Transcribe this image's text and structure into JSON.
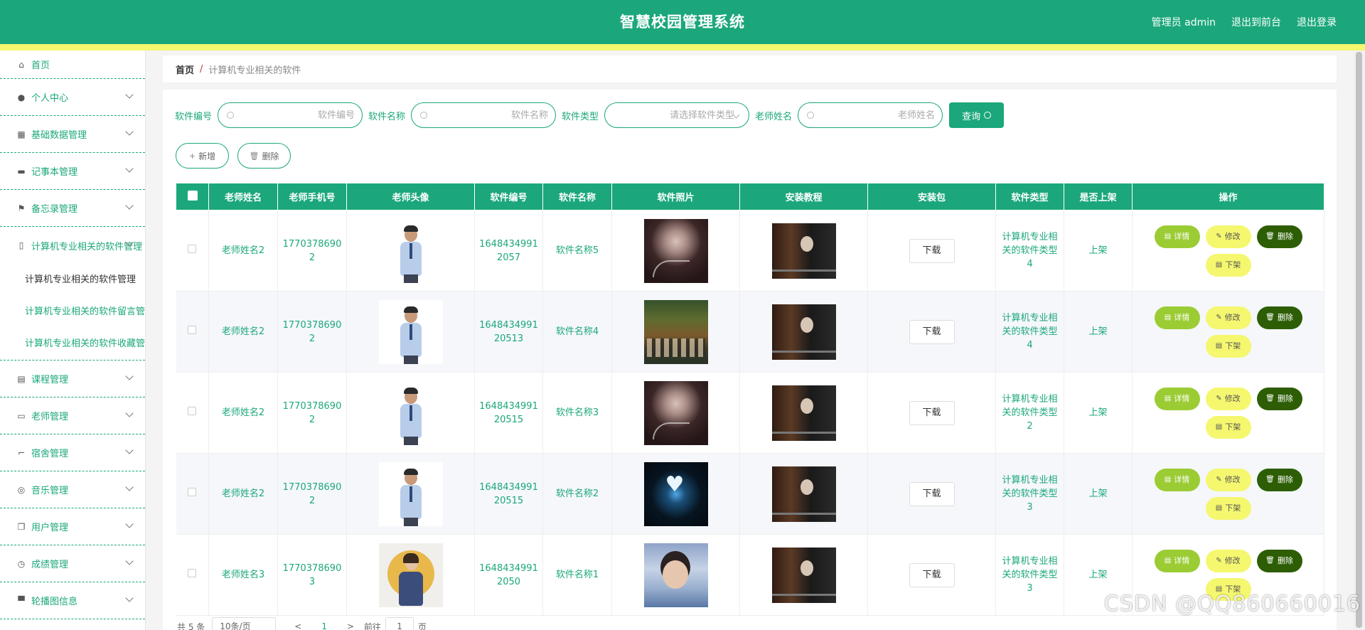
{
  "app": {
    "title": "智慧校园管理系统"
  },
  "topbar": {
    "user": "管理员 admin",
    "to_front": "退出到前台",
    "logout": "退出登录"
  },
  "sidebar": {
    "items": [
      {
        "label": "首页",
        "icon": "home-icon"
      },
      {
        "label": "个人中心",
        "icon": "user-icon"
      },
      {
        "label": "基础数据管理",
        "icon": "grid-icon"
      },
      {
        "label": "记事本管理",
        "icon": "briefcase-icon"
      },
      {
        "label": "备忘录管理",
        "icon": "flag-icon"
      },
      {
        "label": "计算机专业相关的软件管理",
        "icon": "mic-icon"
      },
      {
        "label": "课程管理",
        "icon": "clipboard-icon"
      },
      {
        "label": "老师管理",
        "icon": "id-card-icon"
      },
      {
        "label": "宿舍管理",
        "icon": "crop-icon"
      },
      {
        "label": "音乐管理",
        "icon": "aperture-icon"
      },
      {
        "label": "用户管理",
        "icon": "copy-icon"
      },
      {
        "label": "成绩管理",
        "icon": "compass-icon"
      },
      {
        "label": "轮播图信息",
        "icon": "stamp-icon"
      }
    ],
    "submenu": [
      "计算机专业相关的软件管理",
      "计算机专业相关的软件留言管理",
      "计算机专业相关的软件收藏管理"
    ]
  },
  "breadcrumb": {
    "home": "首页",
    "sep": "/",
    "current": "计算机专业相关的软件"
  },
  "search": {
    "labels": {
      "number": "软件编号",
      "name": "软件名称",
      "type": "软件类型",
      "teacher": "老师姓名"
    },
    "placeholders": {
      "number": "软件编号",
      "name": "软件名称",
      "type": "请选择软件类型",
      "teacher": "老师姓名"
    },
    "query_label": "查询"
  },
  "actions": {
    "add": "新增",
    "delete": "删除"
  },
  "table": {
    "headers": [
      "老师姓名",
      "老师手机号",
      "老师头像",
      "软件编号",
      "软件名称",
      "软件照片",
      "安装教程",
      "安装包",
      "软件类型",
      "是否上架",
      "操作"
    ],
    "download_label": "下载",
    "op_labels": {
      "detail": "详情",
      "edit": "修改",
      "delete": "删除",
      "down": "下架"
    },
    "rows": [
      {
        "teacher": "老师姓名2",
        "phone": "17703786902",
        "number": "16484349912057",
        "name": "软件名称5",
        "type": "计算机专业相关的软件类型4",
        "status": "上架",
        "avatar": "male",
        "photo": "photo1"
      },
      {
        "teacher": "老师姓名2",
        "phone": "17703786902",
        "number": "164843499120513",
        "name": "软件名称4",
        "type": "计算机专业相关的软件类型4",
        "status": "上架",
        "avatar": "male",
        "photo": "photo2"
      },
      {
        "teacher": "老师姓名2",
        "phone": "17703786902",
        "number": "164843499120515",
        "name": "软件名称3",
        "type": "计算机专业相关的软件类型2",
        "status": "上架",
        "avatar": "male",
        "photo": "photo1"
      },
      {
        "teacher": "老师姓名2",
        "phone": "17703786902",
        "number": "164843499120515",
        "name": "软件名称2",
        "type": "计算机专业相关的软件类型3",
        "status": "上架",
        "avatar": "male",
        "photo": "photo3"
      },
      {
        "teacher": "老师姓名3",
        "phone": "17703786903",
        "number": "16484349912050",
        "name": "软件名称1",
        "type": "计算机专业相关的软件类型3",
        "status": "上架",
        "avatar": "female",
        "photo": "photo4"
      }
    ]
  },
  "pagination": {
    "total": "共 5 条",
    "size": "10条/页",
    "prev": "<",
    "page": "1",
    "next": ">",
    "goto": "前往",
    "goto_value": "1",
    "page_unit": "页"
  },
  "watermark": "CSDN @QQ860660016",
  "colors": {
    "primary": "#1ba77b",
    "accent_yellow": "#f5f76f",
    "detail_green": "#9bcc34",
    "delete_dark": "#2d5e05"
  }
}
